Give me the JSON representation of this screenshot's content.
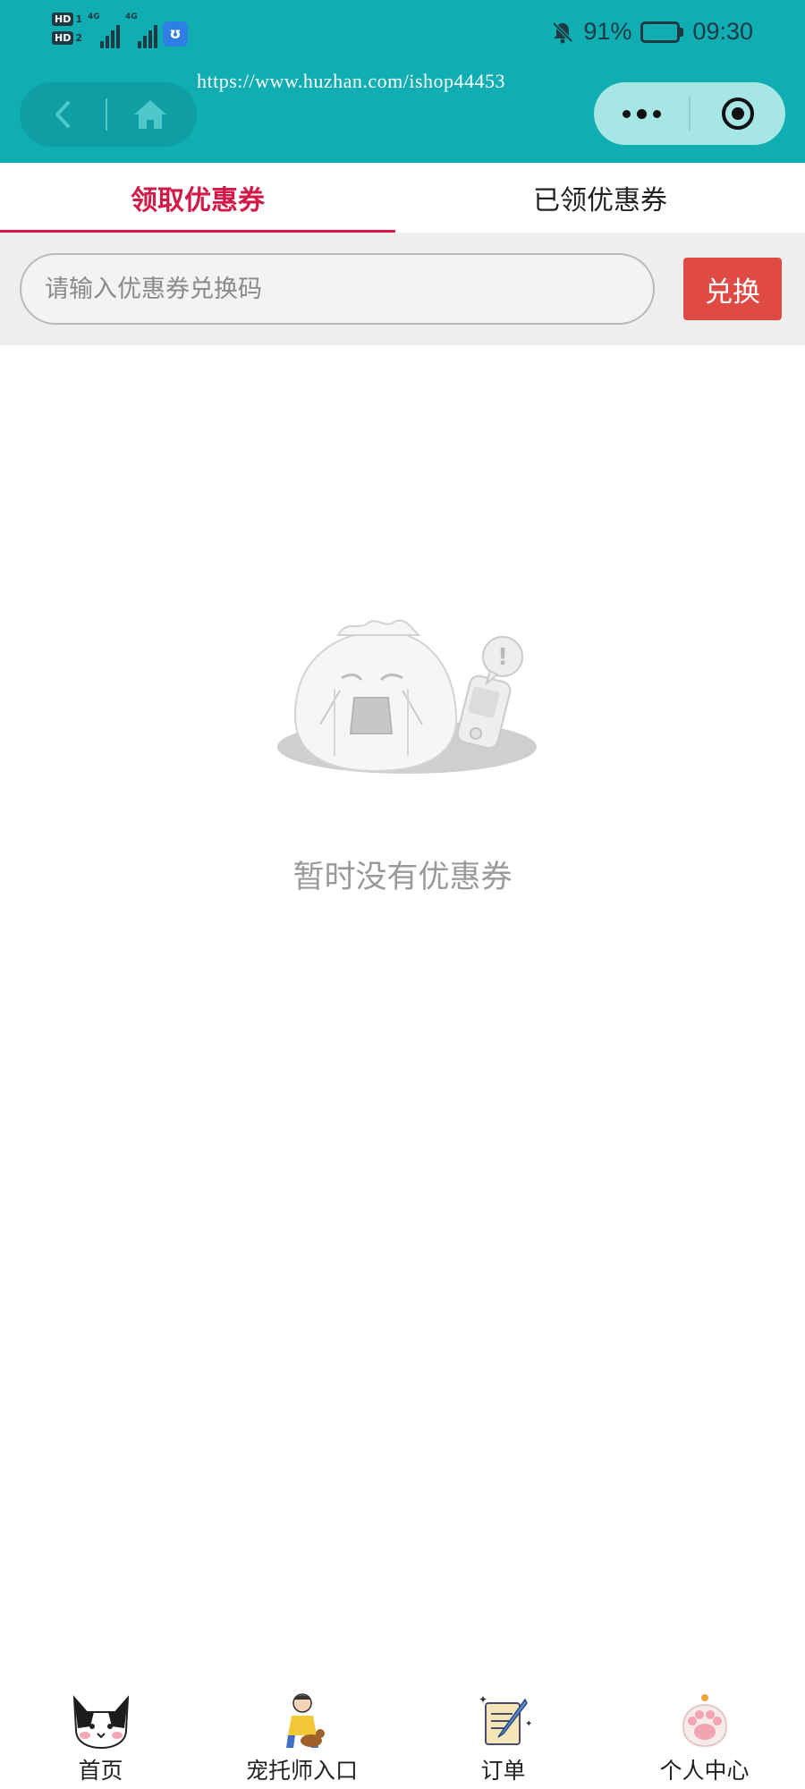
{
  "status_bar": {
    "hd1": "HD",
    "hd1_num": "1",
    "hd2": "HD",
    "hd2_num": "2",
    "net1": "4G",
    "net2": "4G",
    "battery_percent": "91%",
    "battery_level": 0.91,
    "time": "09:30"
  },
  "nav": {
    "watermark": "https://www.huzhan.com/ishop44453"
  },
  "tabs": [
    {
      "label": "领取优惠券",
      "active": true
    },
    {
      "label": "已领优惠券",
      "active": false
    }
  ],
  "redeem": {
    "placeholder": "请输入优惠券兑换码",
    "value": "",
    "button_label": "兑换"
  },
  "empty_state": {
    "message": "暂时没有优惠券"
  },
  "tabbar": [
    {
      "label": "首页",
      "icon": "cat-icon"
    },
    {
      "label": "宠托师入口",
      "icon": "pet-sitter-icon"
    },
    {
      "label": "订单",
      "icon": "order-note-icon"
    },
    {
      "label": "个人中心",
      "icon": "paw-icon"
    }
  ],
  "colors": {
    "header": "#10aeb3",
    "accent": "#d11a47",
    "button": "#e04a45"
  }
}
